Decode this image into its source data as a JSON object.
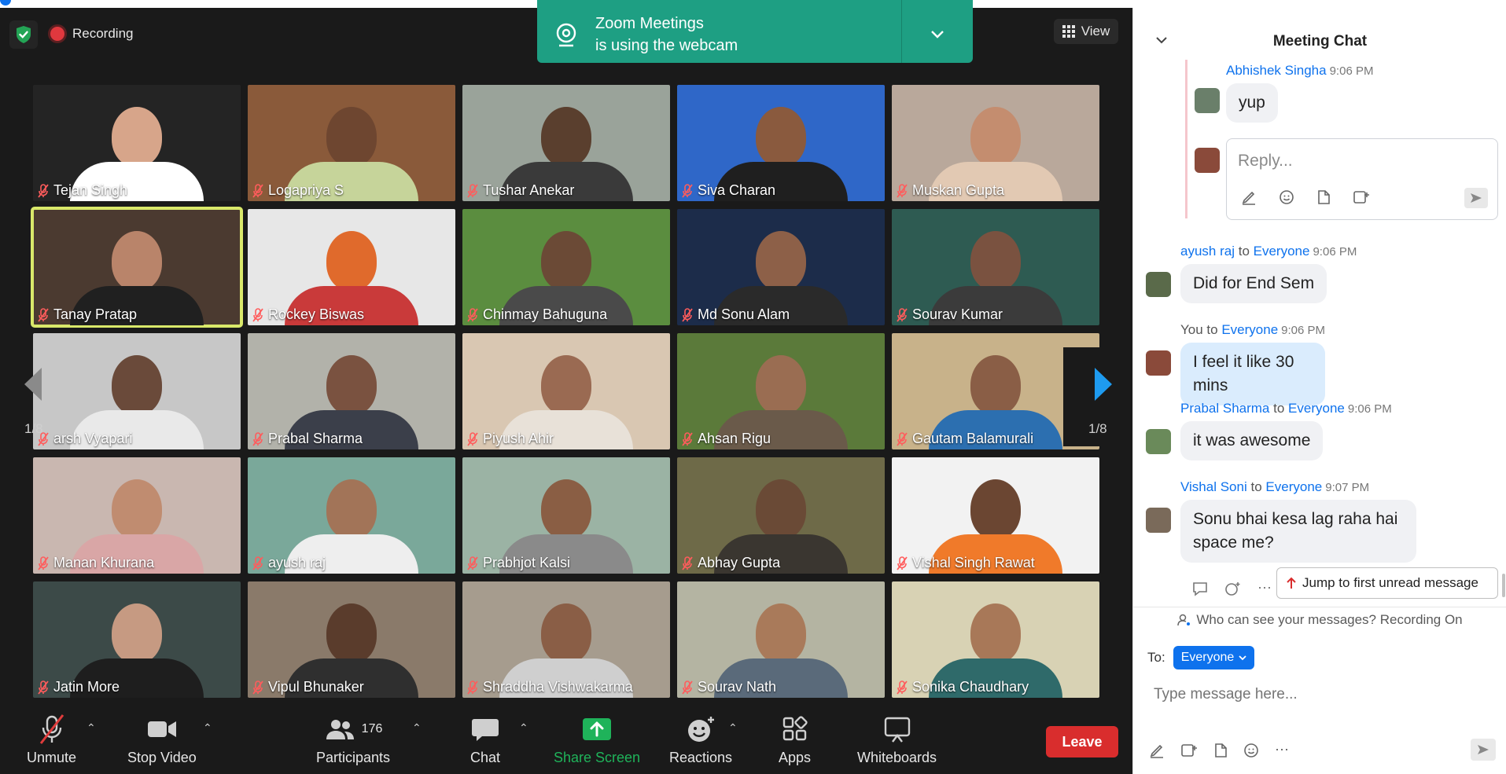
{
  "recording": {
    "label": "Recording"
  },
  "view": {
    "label": "View"
  },
  "notification": {
    "line1": "Zoom Meetings",
    "line2": "is using the webcam"
  },
  "pagination": {
    "left": "1/8",
    "right": "1/8"
  },
  "participants": [
    {
      "name": "Tejan Singh",
      "bg": "#242424",
      "skin": "#d7a58a",
      "shirt": "#ffffff",
      "active": false
    },
    {
      "name": "Logapriya S",
      "bg": "#8a5a3a",
      "skin": "#6e4630",
      "shirt": "#c6d49a",
      "active": false
    },
    {
      "name": "Tushar Anekar",
      "bg": "#9aa39a",
      "skin": "#5a3f2e",
      "shirt": "#3a3a3a",
      "active": false
    },
    {
      "name": "Siva Charan",
      "bg": "#2f67c8",
      "skin": "#8a5a3e",
      "shirt": "#1f1f1f",
      "active": false
    },
    {
      "name": "Muskan Gupta",
      "bg": "#b9a89b",
      "skin": "#c48d6f",
      "shirt": "#e2c9b3",
      "active": false
    },
    {
      "name": "Tanay Pratap",
      "bg": "#4b3a30",
      "skin": "#b9846a",
      "shirt": "#202020",
      "active": true
    },
    {
      "name": "Rockey Biswas",
      "bg": "#e7e7e7",
      "skin": "#e06a2c",
      "shirt": "#c93a3a",
      "active": false
    },
    {
      "name": "Chinmay Bahuguna",
      "bg": "#5b8d3f",
      "skin": "#6b4a36",
      "shirt": "#4a4a4a",
      "active": false
    },
    {
      "name": "Md Sonu Alam",
      "bg": "#1c2c4a",
      "skin": "#8d6048",
      "shirt": "#2a2a2a",
      "active": false
    },
    {
      "name": "Sourav Kumar",
      "bg": "#2e5b52",
      "skin": "#7a5240",
      "shirt": "#3b3b3b",
      "active": false
    },
    {
      "name": "arsh Vyapari",
      "bg": "#c7c7c7",
      "skin": "#6a4a3a",
      "shirt": "#e9e9e9",
      "active": false
    },
    {
      "name": "Prabal Sharma",
      "bg": "#b2b2aa",
      "skin": "#7a5240",
      "shirt": "#3b3f4a",
      "active": false
    },
    {
      "name": "Piyush Ahir",
      "bg": "#d9c7b2",
      "skin": "#9a6a52",
      "shirt": "#e8e1d8",
      "active": false
    },
    {
      "name": "Ahsan Rigu",
      "bg": "#5b7a3a",
      "skin": "#9a6d52",
      "shirt": "#6a5a4a",
      "active": false
    },
    {
      "name": "Gautam Balamurali",
      "bg": "#c8b28a",
      "skin": "#8a5e46",
      "shirt": "#2c6fb0",
      "active": false
    },
    {
      "name": "Manan Khurana",
      "bg": "#c9b7b0",
      "skin": "#c08c70",
      "shirt": "#d9a6a6",
      "active": false
    },
    {
      "name": "ayush raj",
      "bg": "#7aa89a",
      "skin": "#a27458",
      "shirt": "#eeeeee",
      "active": false
    },
    {
      "name": "Prabhjot Kalsi",
      "bg": "#9bb3a4",
      "skin": "#8a5e44",
      "shirt": "#8a8a8a",
      "active": false
    },
    {
      "name": "Abhay Gupta",
      "bg": "#6e6a48",
      "skin": "#6a4a36",
      "shirt": "#3a3630",
      "active": false
    },
    {
      "name": "Vishal Singh Rawat",
      "bg": "#f2f2f2",
      "skin": "#6b4632",
      "shirt": "#f07a2a",
      "active": false
    },
    {
      "name": "Jatin More",
      "bg": "#3c4a48",
      "skin": "#c69a82",
      "shirt": "#1e1e1e",
      "active": false
    },
    {
      "name": "Vipul Bhunaker",
      "bg": "#8a7a6a",
      "skin": "#5a3c2c",
      "shirt": "#2f2f2f",
      "active": false
    },
    {
      "name": "Shraddha Vishwakarma",
      "bg": "#a69c8e",
      "skin": "#8a5e46",
      "shirt": "#cfcfcf",
      "active": false
    },
    {
      "name": "Sourav Nath",
      "bg": "#b4b4a2",
      "skin": "#a97a5a",
      "shirt": "#5a6a7a",
      "active": false
    },
    {
      "name": "Sonika Chaudhary",
      "bg": "#d8d2b4",
      "skin": "#a87858",
      "shirt": "#2f6a6a",
      "active": false
    }
  ],
  "toolbar": {
    "unmute": "Unmute",
    "stop_video": "Stop Video",
    "participants": "Participants",
    "participants_count": "176",
    "chat": "Chat",
    "share_screen": "Share Screen",
    "reactions": "Reactions",
    "apps": "Apps",
    "whiteboards": "Whiteboards",
    "leave": "Leave"
  },
  "chat": {
    "title": "Meeting Chat",
    "reply_placeholder": "Reply...",
    "jump_label": "Jump to first unread message",
    "privacy": "Who can see your messages? Recording On",
    "to_label": "To:",
    "to_value": "Everyone",
    "input_placeholder": "Type message here...",
    "connector": "to",
    "messages": [
      {
        "sender": "Abhishek Singha",
        "recipient": "",
        "time": "9:06 PM",
        "text": "yup"
      },
      {
        "sender": "ayush raj",
        "recipient": "Everyone",
        "time": "9:06 PM",
        "text": "Did for End Sem"
      },
      {
        "sender": "You",
        "recipient": "Everyone",
        "time": "9:06 PM",
        "text": "I feel it like 30 mins"
      },
      {
        "sender": "Prabal Sharma",
        "recipient": "Everyone",
        "time": "9:06 PM",
        "text": "it was awesome"
      },
      {
        "sender": "Vishal Soni",
        "recipient": "Everyone",
        "time": "9:07 PM",
        "text": "Sonu bhai kesa lag raha hai space me?"
      }
    ]
  },
  "colors": {
    "accent": "#0e72ed",
    "notice": "#1e9f83",
    "leave": "#d92d2d",
    "share": "#1fb35a"
  }
}
